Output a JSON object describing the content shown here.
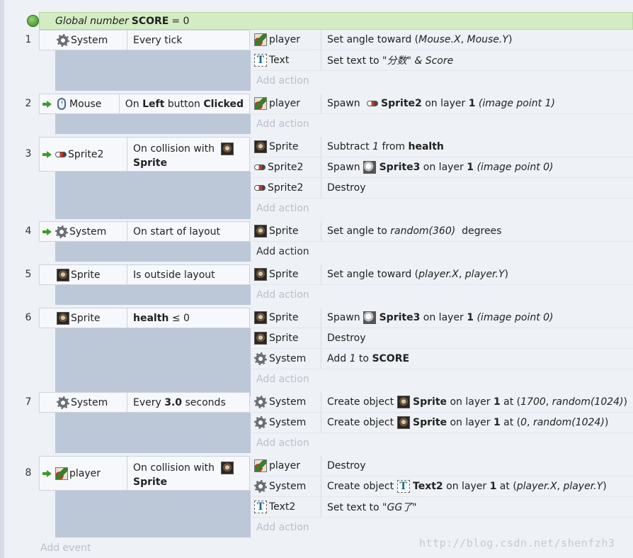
{
  "global_var": {
    "prefix": "Global number",
    "name": "SCORE",
    "suffix": "= 0"
  },
  "events": [
    {
      "num": "1",
      "cond_obj": "System",
      "cond_text": "Every tick",
      "actions": [
        {
          "obj": "player",
          "text": "Set angle toward (Mouse.X, Mouse.Y)"
        },
        {
          "obj": "Text",
          "text": "Set text to \"分数\" & Score"
        }
      ],
      "add_action": "Add action"
    },
    {
      "num": "2",
      "cond_obj": "Mouse",
      "cond_text": "On Left button Clicked",
      "actions": [
        {
          "obj": "player",
          "text": "Spawn Sprite2 on layer 1 (image point 1)"
        }
      ],
      "add_action": "Add action"
    },
    {
      "num": "3",
      "cond_obj": "Sprite2",
      "cond_text": "On collision with Sprite",
      "actions": [
        {
          "obj": "Sprite",
          "text": "Subtract 1 from health"
        },
        {
          "obj": "Sprite2",
          "text": "Spawn Sprite3 on layer 1 (image point 0)"
        },
        {
          "obj": "Sprite2",
          "text": "Destroy"
        }
      ],
      "add_action": "Add action"
    },
    {
      "num": "4",
      "cond_obj": "System",
      "cond_text": "On start of layout",
      "actions": [
        {
          "obj": "Sprite",
          "text": "Set angle to random(360) degrees"
        }
      ],
      "add_action": "Add action"
    },
    {
      "num": "5",
      "cond_obj": "Sprite",
      "cond_text": "Is outside layout",
      "actions": [
        {
          "obj": "Sprite",
          "text": "Set angle toward (player.X, player.Y)"
        }
      ],
      "add_action": "Add action"
    },
    {
      "num": "6",
      "cond_obj": "Sprite",
      "cond_text": "health ≤ 0",
      "actions": [
        {
          "obj": "Sprite",
          "text": "Spawn Sprite3 on layer 1 (image point 0)"
        },
        {
          "obj": "Sprite",
          "text": "Destroy"
        },
        {
          "obj": "System",
          "text": "Add 1 to SCORE"
        }
      ],
      "add_action": "Add action"
    },
    {
      "num": "7",
      "cond_obj": "System",
      "cond_text": "Every 3.0 seconds",
      "actions": [
        {
          "obj": "System",
          "text": "Create object Sprite on layer 1 at (1700, random(1024))"
        },
        {
          "obj": "System",
          "text": "Create object Sprite on layer 1 at (0, random(1024))"
        }
      ],
      "add_action": "Add action"
    },
    {
      "num": "8",
      "cond_obj": "player",
      "cond_text": "On collision with Sprite",
      "actions": [
        {
          "obj": "player",
          "text": "Destroy"
        },
        {
          "obj": "System",
          "text": "Create object Text2 on layer 1 at (player.X, player.Y)"
        },
        {
          "obj": "Text2",
          "text": "Set text to \"GG了\""
        }
      ],
      "add_action": "Add action"
    }
  ],
  "add_event": "Add event",
  "watermark": "http://blog.csdn.net/shenfzh3"
}
